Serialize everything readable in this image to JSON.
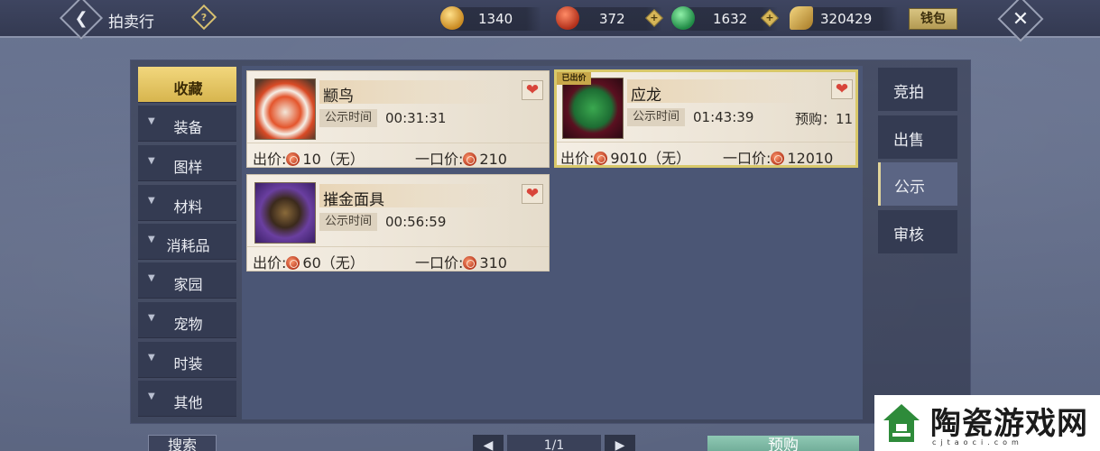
{
  "header": {
    "title": "拍卖行",
    "help_icon": "?",
    "wallet_label": "钱包",
    "currencies": [
      {
        "icon": "gold-ingot-icon",
        "value": "1340",
        "color": "#d9a640"
      },
      {
        "icon": "red-coin-icon",
        "value": "372",
        "color": "#c6452b"
      },
      {
        "icon": "jade-coin-icon",
        "value": "1632",
        "color": "#3aa05a"
      },
      {
        "icon": "silver-leaf-icon",
        "value": "320429",
        "color": "#c8a24c"
      }
    ]
  },
  "categories": [
    {
      "label": "收藏",
      "active": true
    },
    {
      "label": "装备"
    },
    {
      "label": "图样"
    },
    {
      "label": "材料"
    },
    {
      "label": "消耗品"
    },
    {
      "label": "家园"
    },
    {
      "label": "宠物"
    },
    {
      "label": "时装"
    },
    {
      "label": "其他"
    }
  ],
  "right_tabs": [
    {
      "label": "竞拍"
    },
    {
      "label": "出售"
    },
    {
      "label": "公示",
      "active": true
    },
    {
      "label": "审核"
    }
  ],
  "items": [
    {
      "name": "颛鸟",
      "pub_label": "公示时间",
      "pub_time": "00:31:31",
      "bid_label": "出价:",
      "bid_value": "10（无）",
      "buyout_label": "一口价:",
      "buyout_value": "210",
      "has_bid": false
    },
    {
      "name": "应龙",
      "pub_label": "公示时间",
      "pub_time": "01:43:39",
      "preorder_text": "预购：11",
      "bid_label": "出价:",
      "bid_value": "9010（无）",
      "buyout_label": "一口价:",
      "buyout_value": "12010",
      "has_bid": true,
      "bid_ribbon": "已出价"
    },
    {
      "name": "摧金面具",
      "pub_label": "公示时间",
      "pub_time": "00:56:59",
      "bid_label": "出价:",
      "bid_value": "60（无）",
      "buyout_label": "一口价:",
      "buyout_value": "310",
      "has_bid": false
    }
  ],
  "footer": {
    "search_label": "搜索",
    "page_indicator": "1/1",
    "preorder_label": "预购"
  },
  "watermark": {
    "text": "陶瓷游戏网",
    "url": "cjtaoci.com"
  }
}
